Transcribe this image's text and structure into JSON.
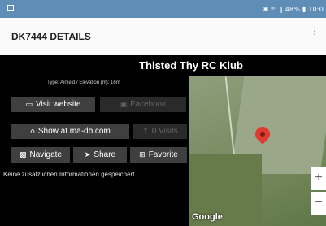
{
  "status_bar": {
    "text": "✱ ⁱ⁶ .∥ 48% ▮ 10:0"
  },
  "header": {
    "title": "DK7444 DETAILS",
    "menu_glyph": "⋮"
  },
  "club": {
    "name": "Thisted Thy RC Klub",
    "meta": "Type: Airfield / Elevation (m): 16m"
  },
  "buttons": {
    "website": {
      "label": "Visit website",
      "icon": "monitor-icon"
    },
    "facebook": {
      "label": "Facebook",
      "icon": "facebook-icon"
    },
    "show_mdb": {
      "label": "Show at ma-db.com",
      "icon": "home-icon"
    },
    "visits": {
      "label": "0 Visits",
      "icon": "thumbs-up-icon"
    },
    "navigate": {
      "label": "Navigate",
      "icon": "car-icon"
    },
    "share": {
      "label": "Share",
      "icon": "share-icon"
    },
    "favorite": {
      "label": "Favorite",
      "icon": "plus-square-icon"
    }
  },
  "info_text": "Keine zusätzlichen Informationen gespeichert",
  "map": {
    "attribution": "Google",
    "zoom_in": "+",
    "zoom_out": "−"
  }
}
